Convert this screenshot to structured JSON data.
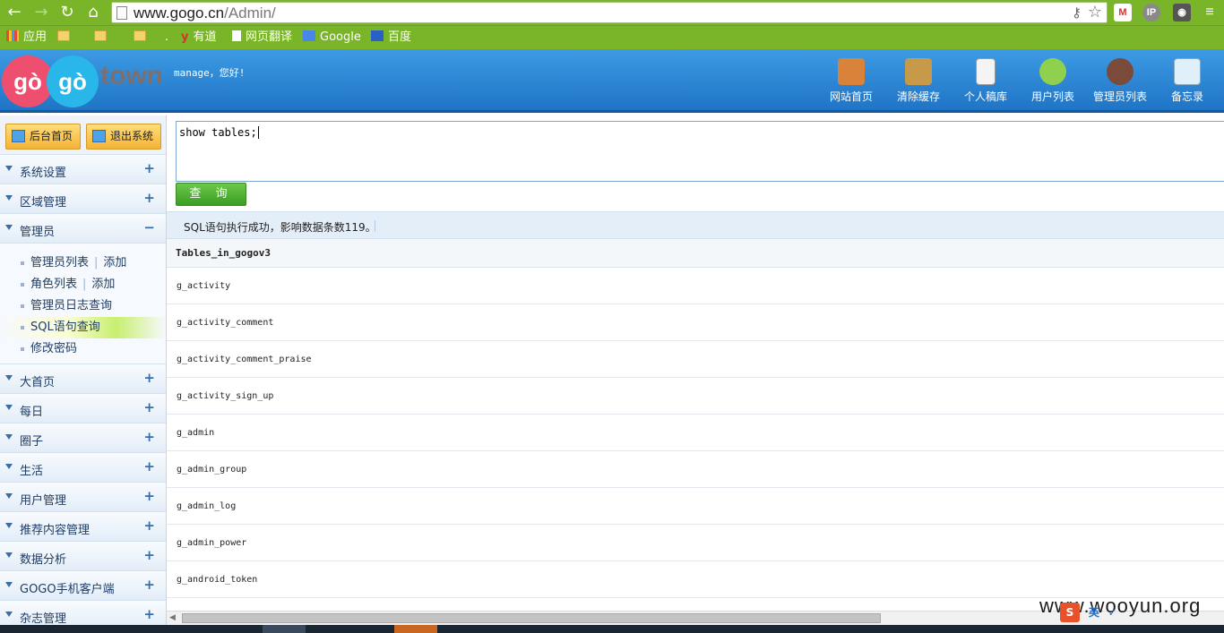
{
  "browser": {
    "url_host": "www.gogo.cn",
    "url_path": "/Admin/",
    "bookmarks": [
      {
        "label": "应用",
        "type": "apps"
      },
      {
        "label": "",
        "type": "folder"
      },
      {
        "label": "",
        "type": "folder"
      },
      {
        "label": "",
        "type": "folder"
      },
      {
        "label": ".",
        "type": "text"
      },
      {
        "label": "有道",
        "type": "youdao"
      },
      {
        "label": "网页翻译",
        "type": "page"
      },
      {
        "label": "Google",
        "type": "google"
      },
      {
        "label": "百度",
        "type": "baidu"
      }
    ],
    "extensions": [
      "M",
      "IP",
      "◉",
      "≡"
    ]
  },
  "header": {
    "logo_left": "gò",
    "logo_right": "gò",
    "logo_town": "town",
    "greeting": "manage，您好!",
    "nav": [
      {
        "label": "网站首页",
        "icon": "home-icon",
        "color": "#d9823a"
      },
      {
        "label": "清除缓存",
        "icon": "broom-icon",
        "color": "#c79a4a"
      },
      {
        "label": "个人稿库",
        "icon": "document-icon",
        "color": "#f4f4f4"
      },
      {
        "label": "用户列表",
        "icon": "users-icon",
        "color": "#8fd14f"
      },
      {
        "label": "管理员列表",
        "icon": "admin-icon",
        "color": "#7a4a3a"
      },
      {
        "label": "备忘录",
        "icon": "memo-icon",
        "color": "#e0f0fa"
      }
    ]
  },
  "sidebar": {
    "top_buttons": [
      "后台首页",
      "退出系统"
    ],
    "sections_before": [
      {
        "label": "系统设置",
        "toggle": "+"
      },
      {
        "label": "区域管理",
        "toggle": "+"
      },
      {
        "label": "管理员",
        "toggle": "−"
      }
    ],
    "admin_items": [
      {
        "label": "管理员列表",
        "extra": "添加"
      },
      {
        "label": "角色列表",
        "extra": "添加"
      },
      {
        "label": "管理员日志查询",
        "extra": ""
      },
      {
        "label": "SQL语句查询",
        "extra": ""
      },
      {
        "label": "修改密码",
        "extra": ""
      }
    ],
    "sections_after": [
      {
        "label": "大首页",
        "toggle": "+"
      },
      {
        "label": "每日",
        "toggle": "+"
      },
      {
        "label": "圈子",
        "toggle": "+"
      },
      {
        "label": "生活",
        "toggle": "+"
      },
      {
        "label": "用户管理",
        "toggle": "+"
      },
      {
        "label": "推荐内容管理",
        "toggle": "+"
      },
      {
        "label": "数据分析",
        "toggle": "+"
      },
      {
        "label": "GOGO手机客户端",
        "toggle": "+"
      },
      {
        "label": "杂志管理",
        "toggle": "+"
      }
    ]
  },
  "main": {
    "sql_text": "show tables;",
    "query_button": "查 询",
    "status": "SQL语句执行成功，影响数据条数119。",
    "column_header": "Tables_in_gogov3",
    "rows": [
      "g_activity",
      "g_activity_comment",
      "g_activity_comment_praise",
      "g_activity_sign_up",
      "g_admin",
      "g_admin_group",
      "g_admin_log",
      "g_admin_power",
      "g_android_token"
    ]
  },
  "watermark": "www.wooyun.org",
  "tray": [
    "S",
    "英",
    "✓"
  ]
}
